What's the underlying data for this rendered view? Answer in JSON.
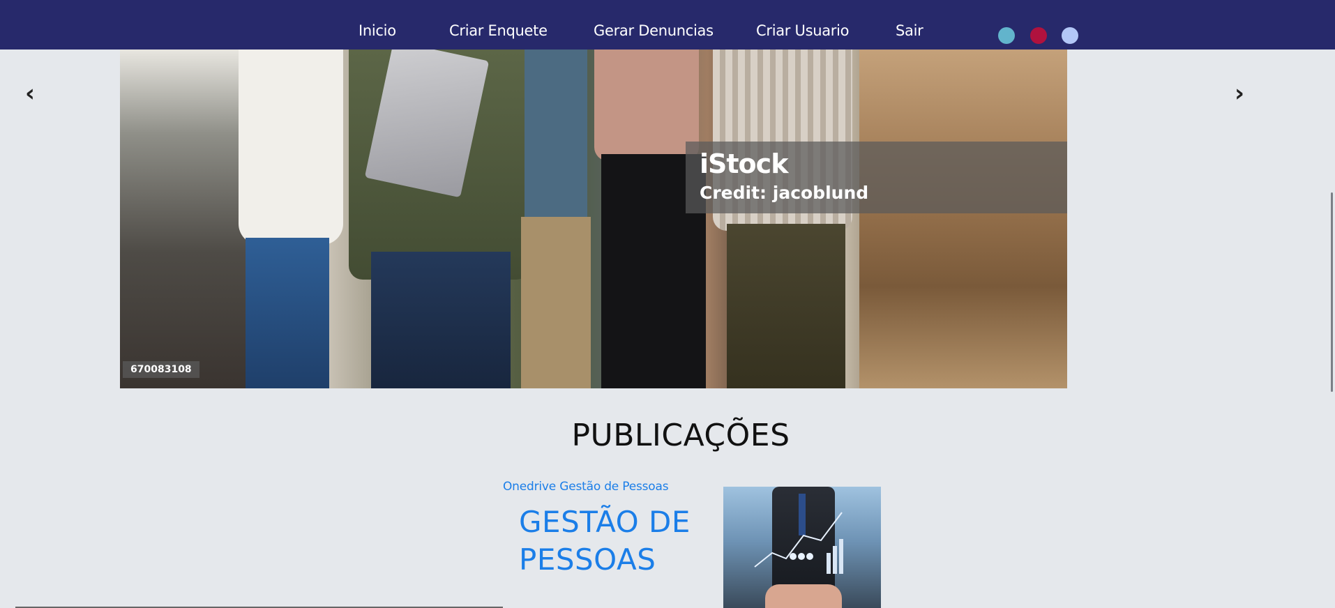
{
  "navbar": {
    "links": [
      "Inicio",
      "Criar Enquete",
      "Gerar Denuncias",
      "Criar Usuario",
      "Sair"
    ],
    "theme_dots": [
      {
        "name": "theme-dot-teal",
        "color": "#62b4cc"
      },
      {
        "name": "theme-dot-crimson",
        "color": "#b0123e"
      },
      {
        "name": "theme-dot-periwinkle",
        "color": "#b3c7f7"
      }
    ],
    "background": "#27296b"
  },
  "carousel": {
    "prev_label": "‹",
    "next_label": "›",
    "watermark": {
      "logo": "iStock",
      "credit": "Credit: jacoblund"
    },
    "image_id": "670083108"
  },
  "publications": {
    "title": "PUBLICAÇÕES",
    "items": [
      {
        "link": "Onedrive Gestão de Pessoas",
        "heading": "GESTÃO DE PESSOAS"
      }
    ]
  },
  "colors": {
    "page_background": "#e5e8ec",
    "link_blue": "#1b7ee8"
  }
}
